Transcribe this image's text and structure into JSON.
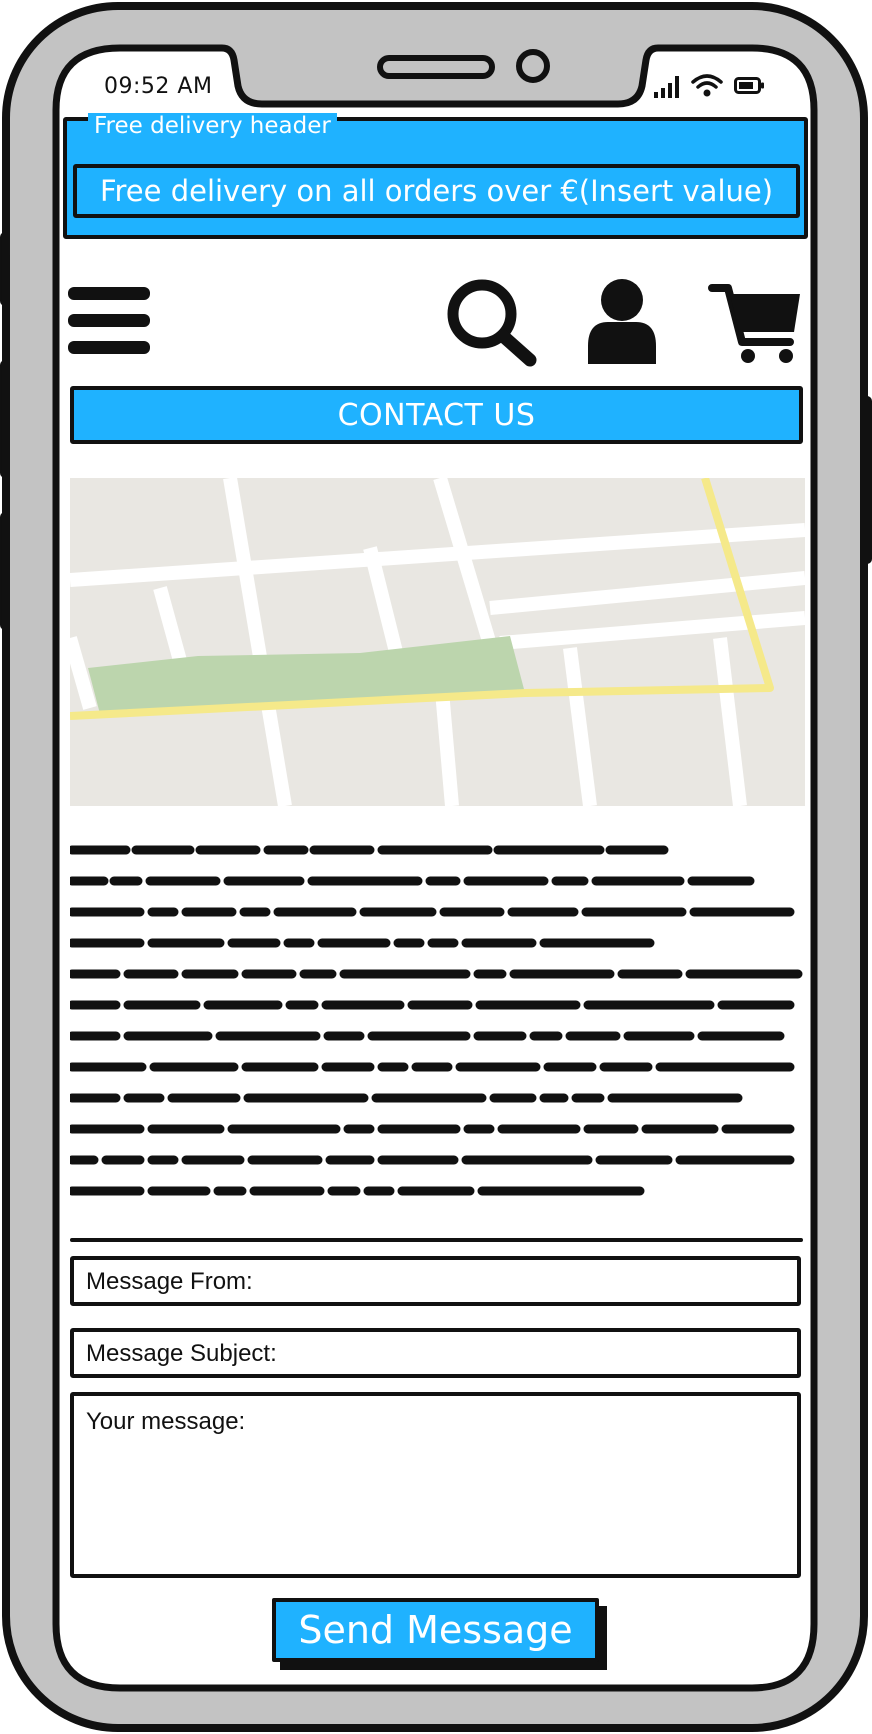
{
  "status_bar": {
    "time": "09:52 AM",
    "icons": [
      "signal-icon",
      "wifi-icon",
      "battery-icon"
    ]
  },
  "promo": {
    "legend": "Free delivery header",
    "text": "Free delivery on all orders over €(Insert value)"
  },
  "nav": {
    "icons": [
      "menu-icon",
      "search-icon",
      "user-icon",
      "cart-icon"
    ]
  },
  "page": {
    "title": "CONTACT US"
  },
  "map": {
    "icon": "map-image"
  },
  "body_text": {
    "placeholder": "scribbled placeholder text"
  },
  "form": {
    "from_label": "Message From:",
    "subject_label": "Message Subject:",
    "message_label": "Your message:",
    "send_label": "Send Message"
  },
  "colors": {
    "accent": "#1fb2ff",
    "outline": "#111111",
    "device_frame": "#c3c3c3",
    "map_bg": "#e9e7e2",
    "map_park": "#bcd5ad",
    "map_road_major": "#f5e98a"
  }
}
